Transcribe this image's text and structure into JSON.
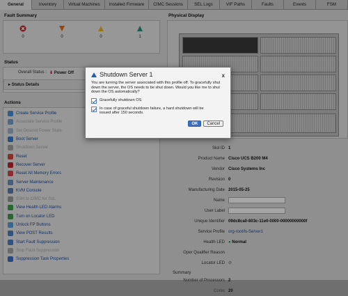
{
  "tabs": [
    "General",
    "Inventory",
    "Virtual Machines",
    "Installed Firmware",
    "CIMC Sessions",
    "SEL Logs",
    "VIF Paths",
    "Faults",
    "Events",
    "FSM"
  ],
  "fault_summary": {
    "title": "Fault Summary",
    "counts": [
      "0",
      "0",
      "0",
      "1"
    ]
  },
  "status": {
    "title": "Status",
    "overall_label": "Overall Status :",
    "overall_value": "Power Off",
    "details": "Status Details"
  },
  "actions": {
    "title": "Actions",
    "items": [
      "Create Service Profile",
      "Associate Service Profile",
      "Set Desired Power State",
      "Boot Server",
      "Shutdown Server",
      "Reset",
      "Recover Server",
      "Reset All Memory Errors",
      "Server Maintenance",
      "KVM Console",
      "SSH to CIMC for SoL",
      "View Health LED Alarms",
      "Turn on Locator LED",
      "Unlock FP Buttons",
      "View POST Results",
      "Start Fault Suppression",
      "Stop Fault Suppression",
      "Suppression Task Properties"
    ],
    "dim": [
      1,
      2,
      4,
      10,
      16
    ]
  },
  "physical_display": {
    "title": "Physical Display"
  },
  "properties": {
    "rows": [
      {
        "k": "Slot ID",
        "v": "1"
      },
      {
        "k": "Product Name",
        "v": "Cisco UCS B200 M4"
      },
      {
        "k": "Vendor",
        "v": "Cisco Systems Inc"
      },
      {
        "k": "Revision",
        "v": "0"
      },
      {
        "k": "Manufacturing Date",
        "v": "2015-05-25"
      },
      {
        "k": "Name",
        "v": ""
      },
      {
        "k": "User Label",
        "v": ""
      },
      {
        "k": "Unique Identifier",
        "v": "09dc8ca0-803c-11e0-0000-00000000000f"
      },
      {
        "k": "Service Profile",
        "v": "org-root/ls-Server1"
      },
      {
        "k": "Health LED",
        "v": "Normal"
      },
      {
        "k": "Oper Qualifier Reason",
        "v": ""
      },
      {
        "k": "Locator LED",
        "v": ""
      }
    ],
    "summary_title": "Summary",
    "summary": [
      {
        "k": "Number of Processors",
        "v": "2"
      },
      {
        "k": "Cores",
        "v": "20"
      }
    ]
  },
  "dialog": {
    "title": "Shutdown Server 1",
    "close": "x",
    "message": "You are turning the server associated with this profile off. To gracefully shut down the server, the OS needs to be shut down. Would you like me to shut down the OS automatically?",
    "check1": "Gracefully shutdown OS",
    "check2": "In case of graceful shutdown failure, a hard shutdown will be issued after 150 seconds.",
    "ok": "OK",
    "cancel": "Cancel"
  }
}
